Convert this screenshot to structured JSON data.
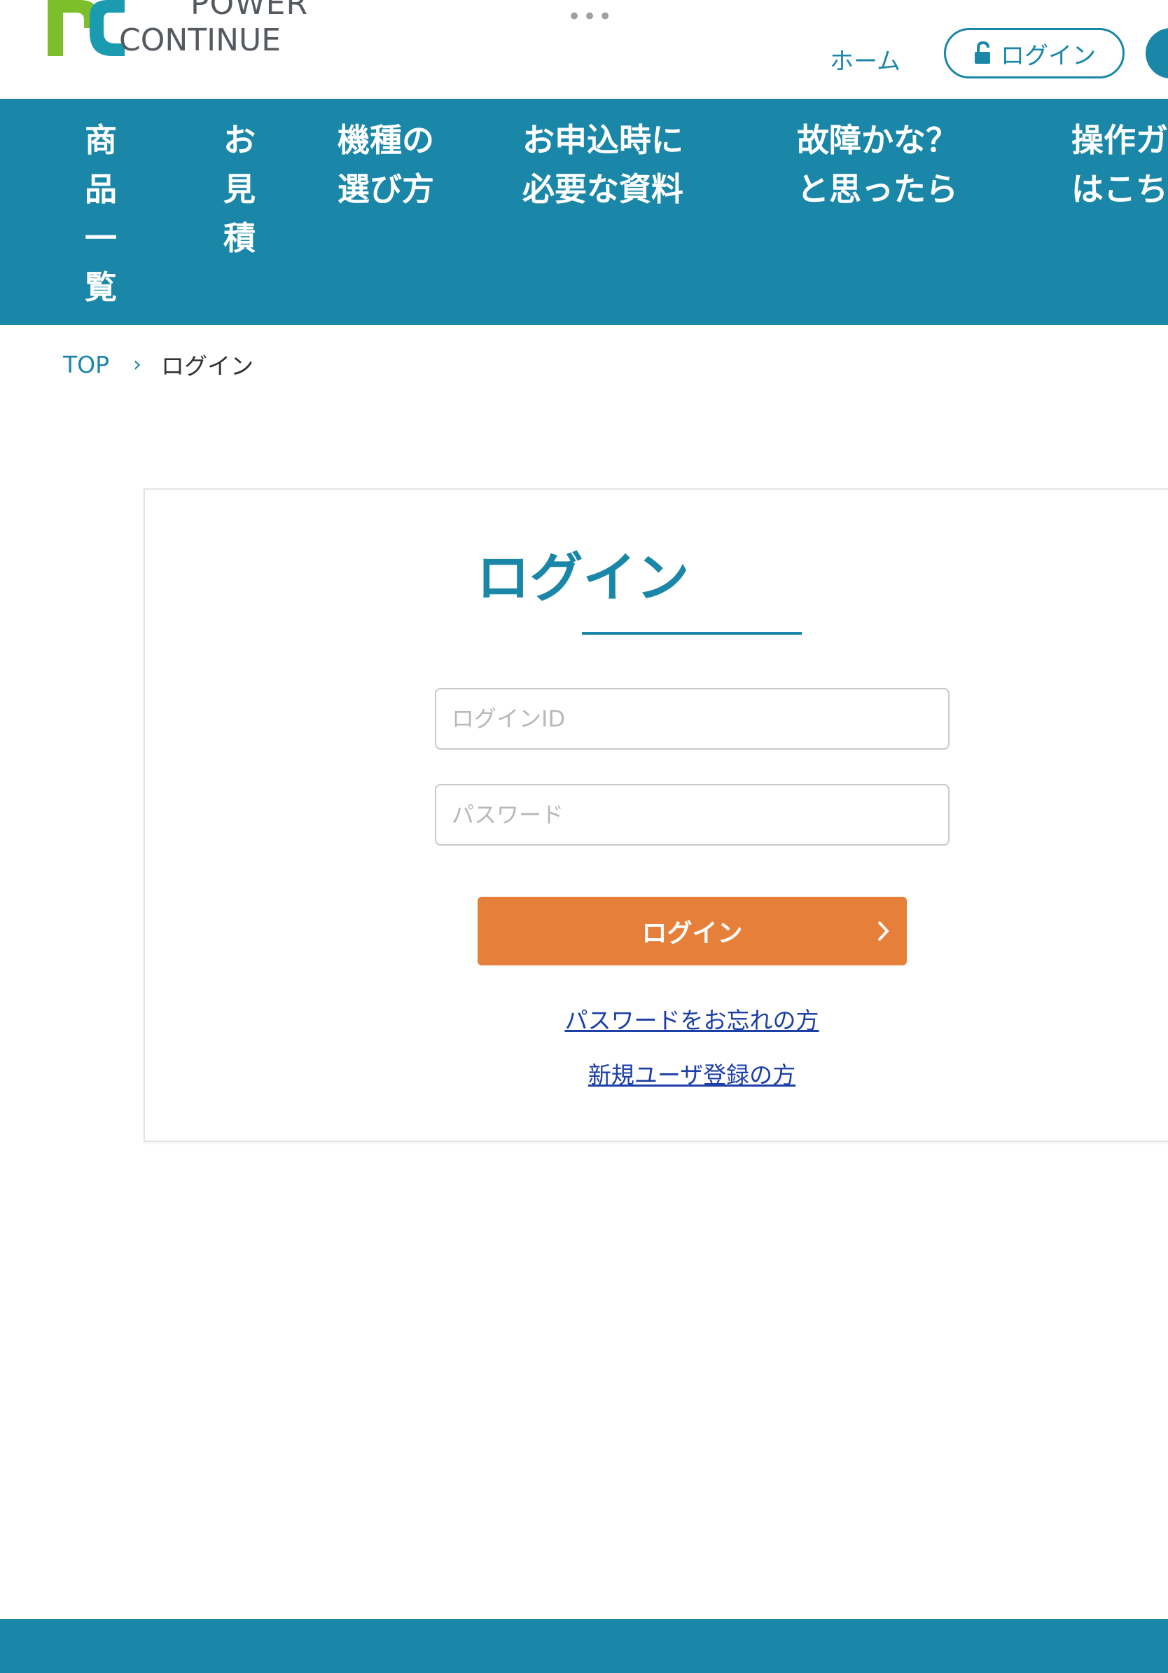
{
  "colors": {
    "primary": "#1a86a8",
    "accent_button": "#e57f3a",
    "link": "#1c3fa8",
    "logo_green": "#7cbf2a",
    "logo_teal": "#1a9bb0"
  },
  "header": {
    "logo_line1": "POWER",
    "logo_line2": "CONTINUE",
    "dots_icon": "more-dots-icon",
    "home_link": "ホーム",
    "login_pill": "ログイン",
    "lock_icon": "unlock-icon"
  },
  "nav": {
    "items": [
      {
        "label": "商品一覧"
      },
      {
        "label": "お見積"
      },
      {
        "label1": "機種の",
        "label2": "選び方"
      },
      {
        "label1": "お申込時に",
        "label2": "必要な資料"
      },
      {
        "label1": "故障かな？",
        "label2": "と思ったら"
      },
      {
        "label1": "操作ガ",
        "label2": "はこち"
      }
    ]
  },
  "breadcrumb": {
    "top": "TOP",
    "separator": "›",
    "current": "ログイン"
  },
  "login": {
    "title": "ログイン",
    "id_placeholder": "ログインID",
    "password_placeholder": "パスワード",
    "button_label": "ログイン",
    "forgot_link": "パスワードをお忘れの方",
    "register_link": "新規ユーザ登録の方"
  }
}
